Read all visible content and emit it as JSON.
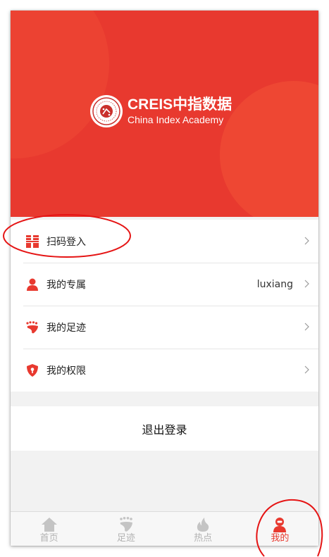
{
  "brand": {
    "title": "CREIS中指数据",
    "subtitle": "China Index Academy",
    "accent": "#e8392f"
  },
  "menu": {
    "items": [
      {
        "label": "扫码登入",
        "value": "",
        "icon": "qr-scan-icon"
      },
      {
        "label": "我的专属",
        "value": "luxiang",
        "icon": "person-icon"
      },
      {
        "label": "我的足迹",
        "value": "",
        "icon": "footprint-icon"
      },
      {
        "label": "我的权限",
        "value": "",
        "icon": "shield-icon"
      }
    ],
    "chevron": ">"
  },
  "logout": {
    "label": "退出登录"
  },
  "tabs": [
    {
      "label": "首页",
      "icon": "home-icon",
      "active": false
    },
    {
      "label": "足迹",
      "icon": "footprint-icon",
      "active": false
    },
    {
      "label": "热点",
      "icon": "flame-icon",
      "active": false
    },
    {
      "label": "我的",
      "icon": "user-icon",
      "active": true
    }
  ]
}
